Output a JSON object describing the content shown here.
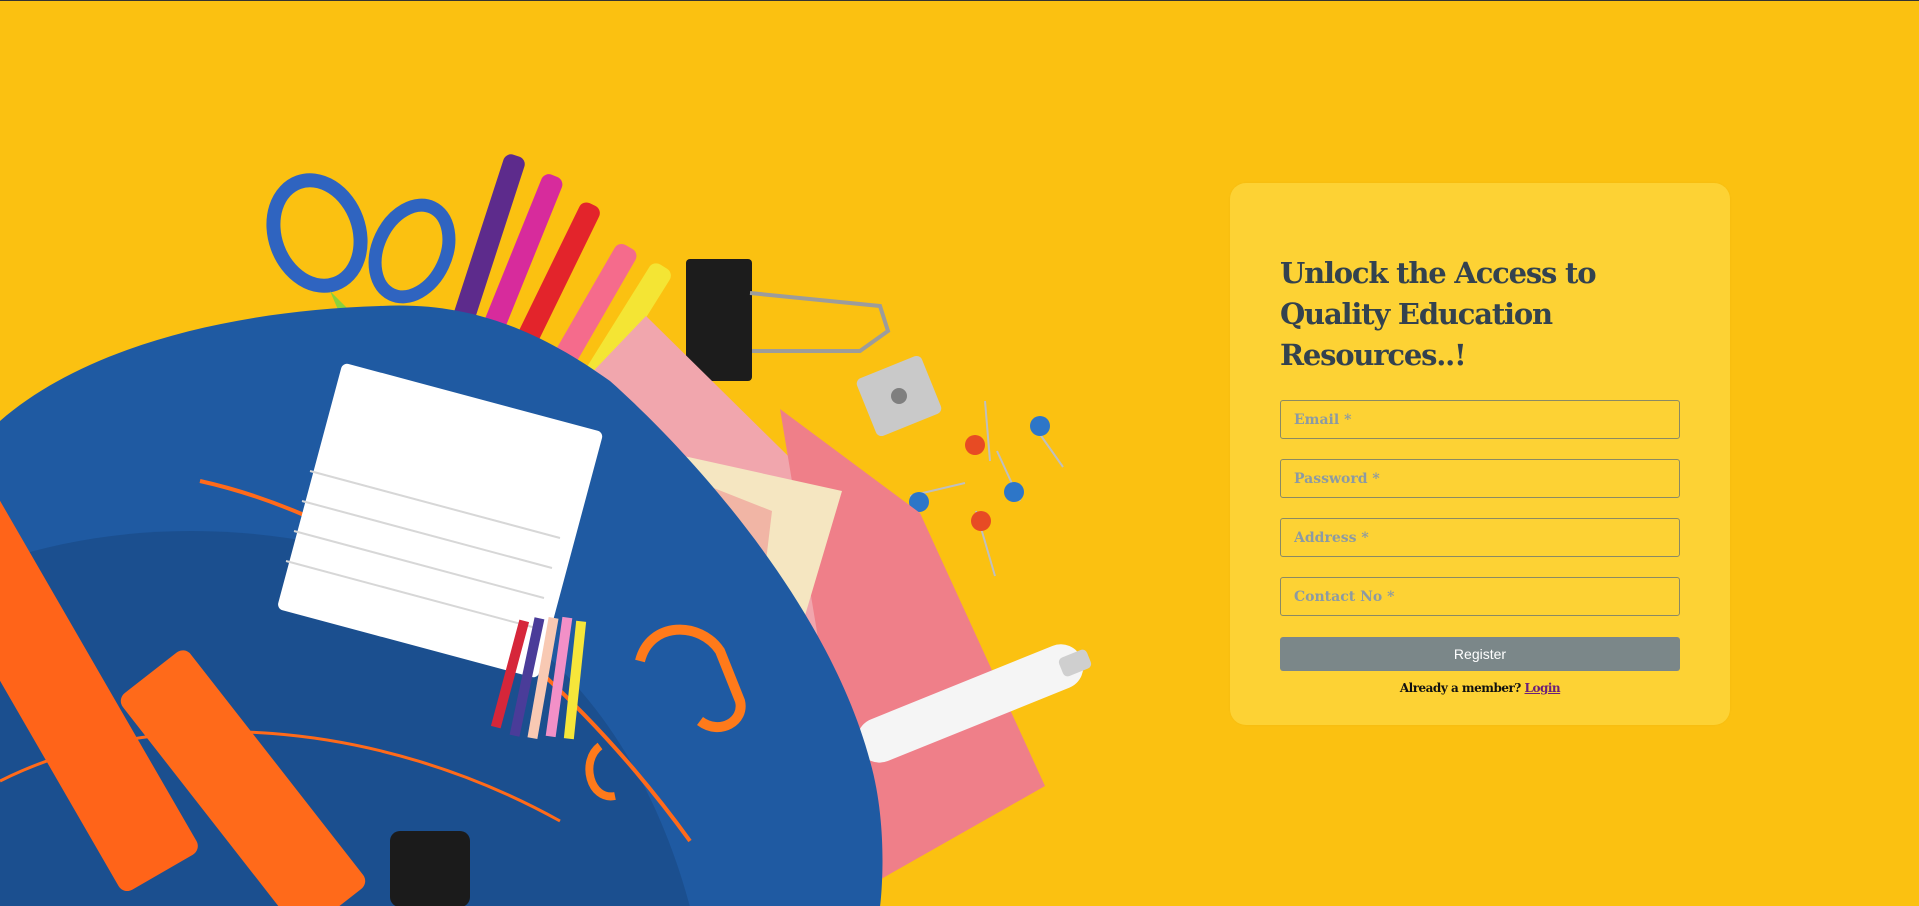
{
  "hero": {
    "image": "backpack-with-school-supplies-illustration"
  },
  "form": {
    "title": "Unlock the Access to Quality Education Resources..!",
    "fields": {
      "email_placeholder": "Email *",
      "password_placeholder": "Password *",
      "address_placeholder": "Address *",
      "contact_placeholder": "Contact No *"
    },
    "register_label": "Register",
    "member_text": "Already a member?",
    "login_label": "Login"
  },
  "colors": {
    "background": "#fbc111",
    "card": "#fdd234",
    "title": "#33424f",
    "button": "#7b8789",
    "link": "#6b1f7a"
  }
}
